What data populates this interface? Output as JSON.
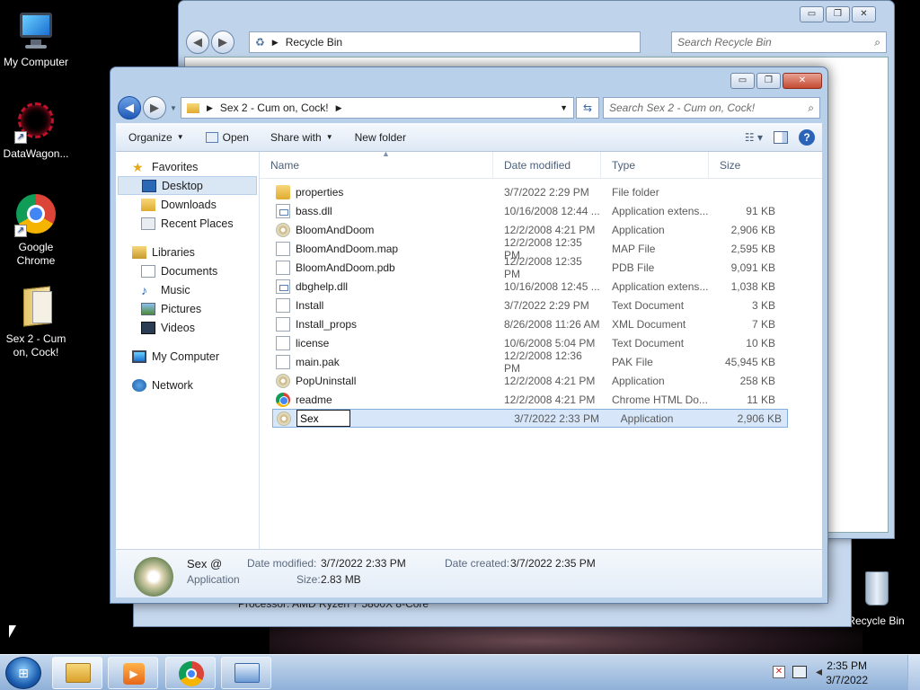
{
  "desktop": {
    "icons": [
      {
        "label": "My Computer"
      },
      {
        "label": "DataWagon..."
      },
      {
        "label": "Google Chrome"
      },
      {
        "label": "Sex 2 - Cum on, Cock!"
      },
      {
        "label": "Recycle Bin"
      }
    ]
  },
  "back_window": {
    "address": "Recycle Bin",
    "search_placeholder": "Search Recycle Bin",
    "min": "▭",
    "max": "❐",
    "close": "✕",
    "partial_text": "Processor: AMD Ryzen 7 5800X 8-Core"
  },
  "window": {
    "min": "▭",
    "max": "❐",
    "close": "✕",
    "address": "Sex 2 - Cum on, Cock!",
    "search_placeholder": "Search Sex 2 - Cum on, Cock!",
    "toolbar": {
      "organize": "Organize",
      "open": "Open",
      "share_with": "Share with",
      "new_folder": "New folder"
    },
    "nav": {
      "favorites": "Favorites",
      "desktop": "Desktop",
      "downloads": "Downloads",
      "recent": "Recent Places",
      "libraries": "Libraries",
      "documents": "Documents",
      "music": "Music",
      "pictures": "Pictures",
      "videos": "Videos",
      "my_computer": "My Computer",
      "network": "Network"
    },
    "columns": {
      "name": "Name",
      "date": "Date modified",
      "type": "Type",
      "size": "Size"
    },
    "files": [
      {
        "name": "properties",
        "date": "3/7/2022 2:29 PM",
        "type": "File folder",
        "size": "",
        "icon": "folder"
      },
      {
        "name": "bass.dll",
        "date": "10/16/2008 12:44 ...",
        "type": "Application extens...",
        "size": "91 KB",
        "icon": "dll"
      },
      {
        "name": "BloomAndDoom",
        "date": "12/2/2008 4:21 PM",
        "type": "Application",
        "size": "2,906 KB",
        "icon": "app"
      },
      {
        "name": "BloomAndDoom.map",
        "date": "12/2/2008 12:35 PM",
        "type": "MAP File",
        "size": "2,595 KB",
        "icon": "doc"
      },
      {
        "name": "BloomAndDoom.pdb",
        "date": "12/2/2008 12:35 PM",
        "type": "PDB File",
        "size": "9,091 KB",
        "icon": "doc"
      },
      {
        "name": "dbghelp.dll",
        "date": "10/16/2008 12:45 ...",
        "type": "Application extens...",
        "size": "1,038 KB",
        "icon": "dll"
      },
      {
        "name": "Install",
        "date": "3/7/2022 2:29 PM",
        "type": "Text Document",
        "size": "3 KB",
        "icon": "doc"
      },
      {
        "name": "Install_props",
        "date": "8/26/2008 11:26 AM",
        "type": "XML Document",
        "size": "7 KB",
        "icon": "doc"
      },
      {
        "name": "license",
        "date": "10/6/2008 5:04 PM",
        "type": "Text Document",
        "size": "10 KB",
        "icon": "doc"
      },
      {
        "name": "main.pak",
        "date": "12/2/2008 12:36 PM",
        "type": "PAK File",
        "size": "45,945 KB",
        "icon": "doc"
      },
      {
        "name": "PopUninstall",
        "date": "12/2/2008 4:21 PM",
        "type": "Application",
        "size": "258 KB",
        "icon": "app"
      },
      {
        "name": "readme",
        "date": "12/2/2008 4:21 PM",
        "type": "Chrome HTML Do...",
        "size": "11 KB",
        "icon": "chrome"
      }
    ],
    "renaming": {
      "value": "Sex",
      "date": "3/7/2022 2:33 PM",
      "type": "Application",
      "size": "2,906 KB"
    },
    "details": {
      "name": "Sex @",
      "kind": "Application",
      "date_modified_label": "Date modified:",
      "date_modified": "3/7/2022 2:33 PM",
      "size_label": "Size:",
      "size": "2.83 MB",
      "date_created_label": "Date created:",
      "date_created": "3/7/2022 2:35 PM"
    }
  },
  "taskbar": {
    "time": "2:35 PM",
    "date": "3/7/2022"
  }
}
